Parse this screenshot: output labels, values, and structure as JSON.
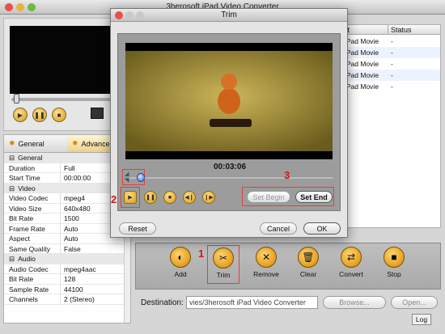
{
  "app": {
    "title": "3herosoft iPad Video Converter"
  },
  "preview": {
    "controls": [
      {
        "name": "play-button",
        "icon": "play-icon"
      },
      {
        "name": "pause-button",
        "icon": "pause-icon"
      },
      {
        "name": "stop-button",
        "icon": "stop-icon"
      }
    ],
    "snapshot_icon": "clapper-icon"
  },
  "properties": {
    "tabs": [
      "General",
      "Advance"
    ],
    "groups": [
      {
        "label": "General",
        "rows": [
          {
            "key": "Duration",
            "value": "Full"
          },
          {
            "key": "Start Time",
            "value": "00:00:00"
          }
        ]
      },
      {
        "label": "Video",
        "rows": [
          {
            "key": "Video Codec",
            "value": "mpeg4"
          },
          {
            "key": "Video Size",
            "value": "640x480"
          },
          {
            "key": "Bit Rate",
            "value": "1500"
          },
          {
            "key": "Frame Rate",
            "value": "Auto"
          },
          {
            "key": "Aspect",
            "value": "Auto"
          },
          {
            "key": "Same Quality",
            "value": "False"
          }
        ]
      },
      {
        "label": "Audio",
        "rows": [
          {
            "key": "Audio Codec",
            "value": "mpeg4aac"
          },
          {
            "key": "Bit Rate",
            "value": "128"
          },
          {
            "key": "Sample Rate",
            "value": "44100"
          },
          {
            "key": "Channels",
            "value": "2 (Stereo)"
          }
        ]
      }
    ]
  },
  "file_table": {
    "headers": [
      "Target",
      "Status"
    ],
    "rows": [
      {
        "target": "iPad Movie",
        "status": "-"
      },
      {
        "target": "iPad Movie",
        "status": "-"
      },
      {
        "target": "iPad Movie",
        "status": "-"
      },
      {
        "target": "iPad Movie",
        "status": "-"
      },
      {
        "target": "iPad Movie",
        "status": "-"
      }
    ]
  },
  "toolbar": {
    "buttons": [
      {
        "label": "Add",
        "icon": "add-icon"
      },
      {
        "label": "Trim",
        "icon": "scissors-icon"
      },
      {
        "label": "Remove",
        "icon": "remove-icon"
      },
      {
        "label": "Clear",
        "icon": "trash-icon"
      },
      {
        "label": "Convert",
        "icon": "convert-icon"
      },
      {
        "label": "Stop",
        "icon": "stop-icon"
      }
    ]
  },
  "destination": {
    "label": "Destination:",
    "path": "vies/3herosoft iPad Video Converter",
    "browse_label": "Browse...",
    "open_label": "Open...",
    "log_label": "Log"
  },
  "trim": {
    "title": "Trim",
    "time": "00:03:06",
    "set_begin_label": "Set Begin",
    "set_end_label": "Set End",
    "reset_label": "Reset",
    "cancel_label": "Cancel",
    "ok_label": "OK",
    "playhead_fraction": 0.06,
    "annotations": [
      "1",
      "2",
      "3"
    ]
  },
  "colors": {
    "accent": "#d99b12",
    "highlight": "#e04040"
  }
}
